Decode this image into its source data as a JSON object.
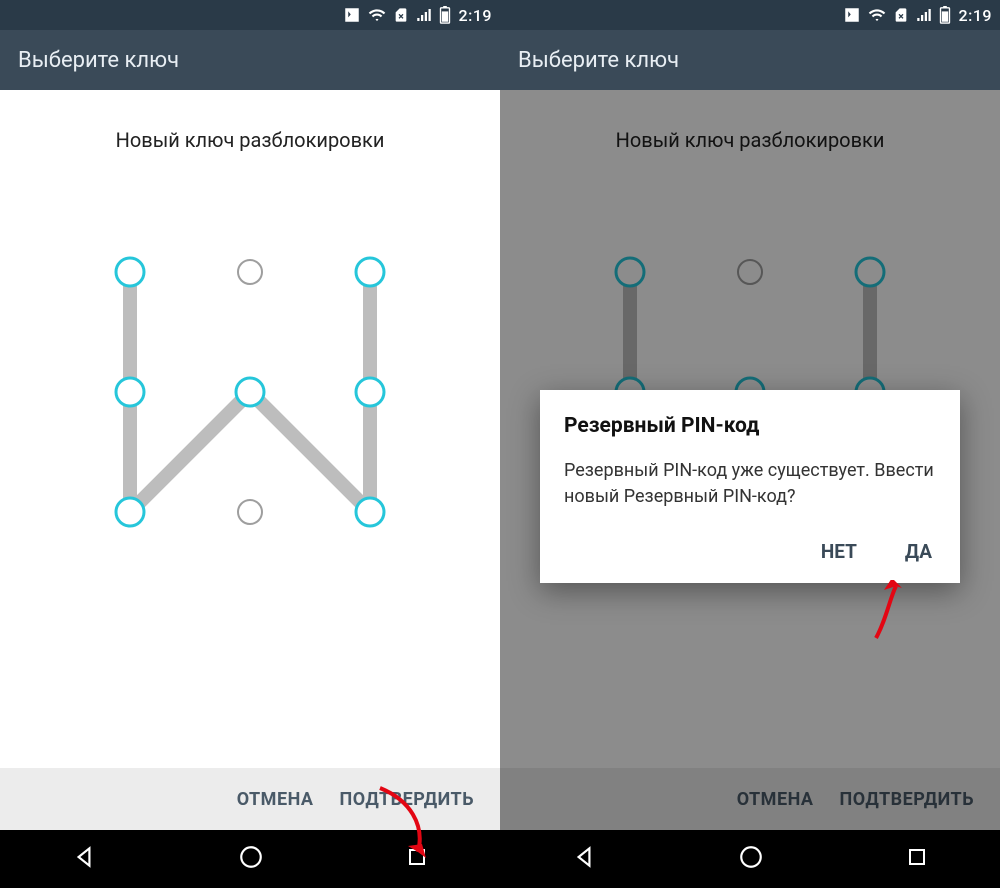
{
  "status": {
    "time": "2:19"
  },
  "header": {
    "title": "Выберите ключ"
  },
  "instruction": "Новый ключ разблокировки",
  "pattern": {
    "active_dots": [
      0,
      2,
      3,
      4,
      5,
      6,
      8
    ],
    "inactive_dots": [
      1,
      7
    ],
    "path": [
      0,
      6,
      4,
      8,
      2
    ]
  },
  "buttons": {
    "cancel": "ОТМЕНА",
    "confirm": "ПОДТВЕРДИТЬ"
  },
  "dialog": {
    "title": "Резервный PIN-код",
    "body": "Резервный PIN-код уже существует. Ввести новый Резервный PIN-код?",
    "no": "НЕТ",
    "yes": "ДА"
  }
}
